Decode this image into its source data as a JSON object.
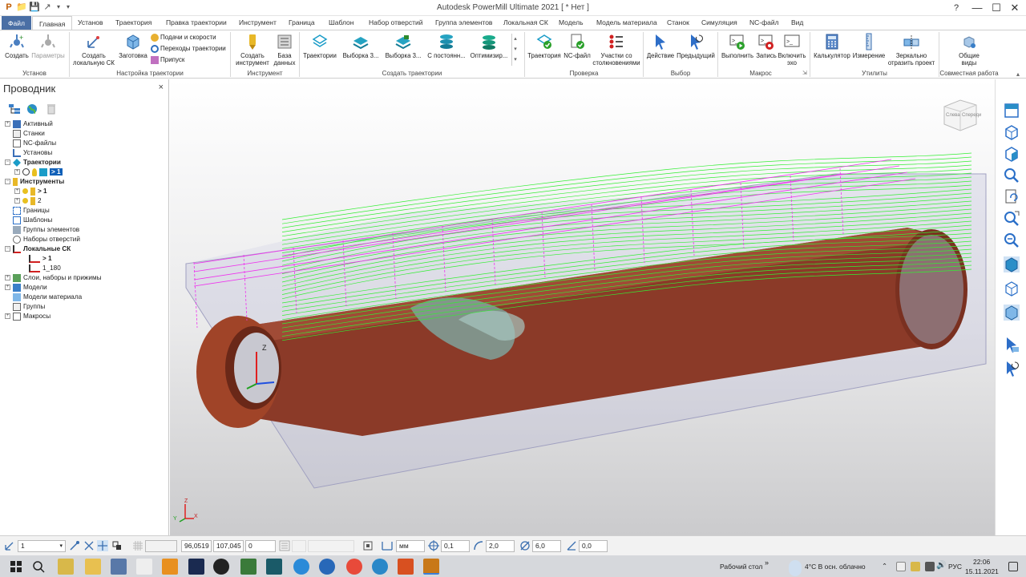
{
  "window": {
    "title": "Autodesk PowerMill Ultimate 2021   [ * Нет ]",
    "help": "?",
    "minimize": "—",
    "maximize": "☐",
    "close": "✕"
  },
  "menu_tabs": [
    "Файл",
    "Главная",
    "Установ",
    "Траектория",
    "Правка траектории",
    "Инструмент",
    "Граница",
    "Шаблон",
    "Набор отверстий",
    "Группа элементов",
    "Локальная СК",
    "Модель",
    "Модель материала",
    "Станок",
    "Симуляция",
    "NC-файл",
    "Вид"
  ],
  "ribbon": {
    "groups": {
      "setup": "Установ",
      "toolpath_setup": "Настройка траектории",
      "tool": "Инструмент",
      "create_toolpaths": "Создать траектории",
      "verify": "Проверка",
      "selection": "Выбор",
      "macro": "Макрос",
      "utilities": "Утилиты",
      "collaboration": "Совместная работа"
    },
    "buttons": {
      "create": "Создать",
      "params": "Параметры",
      "create_ucs": [
        "Создать",
        "локальную СК"
      ],
      "block": "Заготовка",
      "feeds": "Подачи и скорости",
      "leads": "Переходы траектории",
      "thickness": "Припуск",
      "create_tool": [
        "Создать",
        "инструмент"
      ],
      "database": [
        "База",
        "данных"
      ],
      "toolpaths": "Траектории",
      "strategy1": "Выборка 3...",
      "strategy2": "Выборка 3...",
      "strategy3": "С постоянн...",
      "strategy4": "Оптимизир...",
      "verify_toolpath": "Траектория",
      "nc_file": "NC-файл",
      "collisions": [
        "Участки со",
        "столкновениями"
      ],
      "action": "Действие",
      "previous": "Предыдущий",
      "run": "Выполнить",
      "record": "Запись",
      "echo": [
        "Включить",
        "эхо"
      ],
      "calculator": "Калькулятор",
      "measure": "Измерение",
      "mirror": [
        "Зеркально",
        "отразить проект"
      ],
      "shared_views": [
        "Общие",
        "виды"
      ]
    }
  },
  "explorer": {
    "title": "Проводник",
    "close": "×",
    "items": [
      {
        "label": "Активный",
        "bold": false
      },
      {
        "label": "Станки",
        "bold": false
      },
      {
        "label": "NC-файлы",
        "bold": false
      },
      {
        "label": "Установы",
        "bold": false
      },
      {
        "label": "Траектории",
        "bold": true
      },
      {
        "label": "> 1",
        "bold": true
      },
      {
        "label": "Инструменты",
        "bold": true
      },
      {
        "label": "> 1",
        "bold": true
      },
      {
        "label": "2",
        "bold": false
      },
      {
        "label": "Границы",
        "bold": false
      },
      {
        "label": "Шаблоны",
        "bold": false
      },
      {
        "label": "Группы элементов",
        "bold": false
      },
      {
        "label": "Наборы отверстий",
        "bold": false
      },
      {
        "label": "Локальные СК",
        "bold": true
      },
      {
        "label": "> 1",
        "bold": true
      },
      {
        "label": "1_180",
        "bold": false
      },
      {
        "label": "Слои, наборы и прижимы",
        "bold": false
      },
      {
        "label": "Модели",
        "bold": false
      },
      {
        "label": "Модели материала",
        "bold": false
      },
      {
        "label": "Группы",
        "bold": false
      },
      {
        "label": "Макросы",
        "bold": false
      }
    ]
  },
  "viewport": {
    "viewcube": {
      "left": "Слева",
      "front": "Спереди"
    },
    "axis_z": "Z",
    "triad": {
      "x": "X",
      "y": "Y",
      "z": "Z"
    },
    "colors": {
      "stock": "#8a3a26",
      "toolpath": "#33ee33",
      "rapid": "#ee33ee",
      "block": "#b8b8d8"
    }
  },
  "statusbar": {
    "workplane": "1",
    "x": "96,0519",
    "y": "107,045",
    "z": "0",
    "units": "мм",
    "tolerance": "0,1",
    "thickness": "2,0",
    "diameter": "6,0",
    "angle": "0,0"
  },
  "taskbar": {
    "desktop": "Рабочий стол",
    "weather": "4°C  В осн. облачно",
    "lang": "РУС",
    "time": "22:06",
    "date": "15.11.2021"
  }
}
